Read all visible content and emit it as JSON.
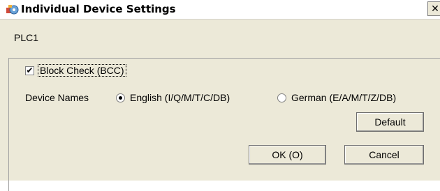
{
  "window": {
    "title": "Individual Device Settings",
    "close_glyph": "✕",
    "icon": "settings-gear-icon"
  },
  "device": {
    "name": "PLC1"
  },
  "settings": {
    "block_check": {
      "label": "Block Check (BCC)",
      "checked": true,
      "check_glyph": "✔"
    },
    "device_names": {
      "label": "Device Names",
      "options": [
        {
          "label": "English (I/Q/M/T/C/DB)",
          "selected": true
        },
        {
          "label": "German (E/A/M/T/Z/DB)",
          "selected": false
        }
      ]
    }
  },
  "buttons": {
    "default_label": "Default",
    "ok_label": "OK (O)",
    "cancel_label": "Cancel"
  }
}
